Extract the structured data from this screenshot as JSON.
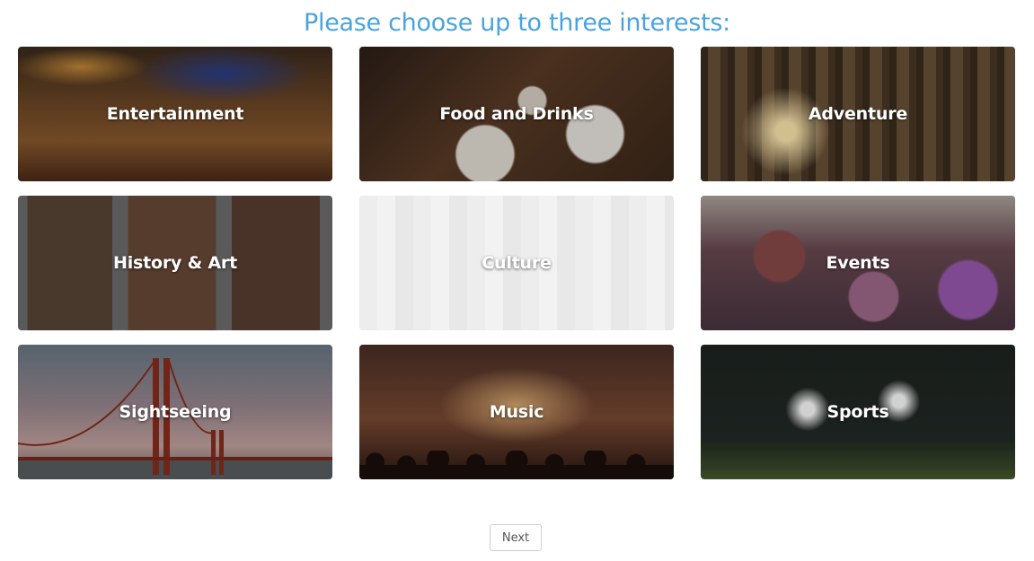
{
  "page": {
    "heading": "Please choose up to three interests:",
    "heading_color": "#4aa3df"
  },
  "interests": [
    {
      "label": "Entertainment",
      "scene": "theater-interior"
    },
    {
      "label": "Food and Drinks",
      "scene": "restaurant-table"
    },
    {
      "label": "Adventure",
      "scene": "forest-sunset"
    },
    {
      "label": "History & Art",
      "scene": "museum-paintings"
    },
    {
      "label": "Culture",
      "scene": "chinatown-street",
      "state": "faded"
    },
    {
      "label": "Events",
      "scene": "color-festival-crowd"
    },
    {
      "label": "Sightseeing",
      "scene": "golden-gate-bridge"
    },
    {
      "label": "Music",
      "scene": "concert-crowd"
    },
    {
      "label": "Sports",
      "scene": "baseball-stadium-night"
    }
  ],
  "actions": {
    "next_label": "Next"
  }
}
